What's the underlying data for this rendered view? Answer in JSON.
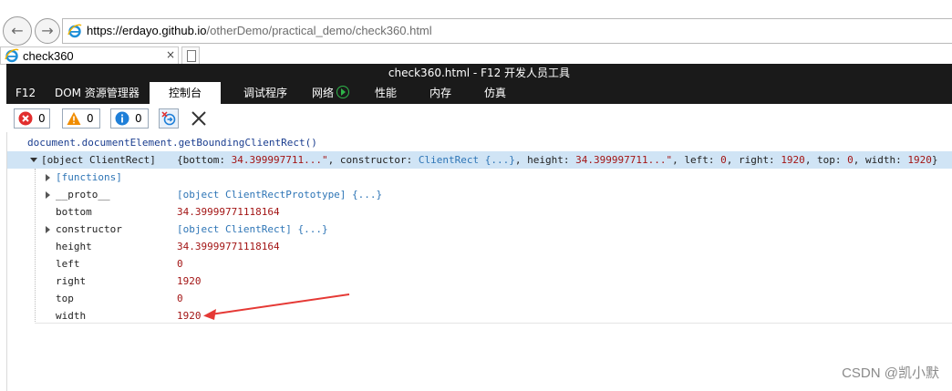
{
  "browser": {
    "url_host": "https://erdayo.github.io",
    "url_path": "/otherDemo/practical_demo/check360.html",
    "tab_title": "check360",
    "tab_close": "×"
  },
  "devtools": {
    "window_title": "check360.html - F12 开发人员工具",
    "tabs": [
      "F12",
      "DOM 资源管理器",
      "控制台",
      "调试程序",
      "网络",
      "性能",
      "内存",
      "仿真"
    ],
    "active_tab": "控制台",
    "counts": {
      "errors": "0",
      "warnings": "0",
      "messages": "0"
    }
  },
  "console": {
    "input": "document.documentElement.getBoundingClientRect()",
    "result_label": "[object ClientRect]",
    "summary": {
      "open": "{bottom: ",
      "bottom": "34.399997711...\"",
      "sep1": ", constructor: ",
      "ctor": "ClientRect {...}",
      "sep2": ", height: ",
      "height": "34.399997711...\"",
      "sep3": ", left: ",
      "left": "0",
      "sep4": ", right: ",
      "right": "1920",
      "sep5": ", top: ",
      "top": "0",
      "sep6": ", width: ",
      "width": "1920",
      "close": "}"
    },
    "props": {
      "functions": "[functions]",
      "proto_key": "__proto__",
      "proto_val": "[object ClientRectPrototype] {...}",
      "bottom_key": "bottom",
      "bottom_val": "34.39999771118164",
      "ctor_key": "constructor",
      "ctor_val": "[object ClientRect] {...}",
      "height_key": "height",
      "height_val": "34.39999771118164",
      "left_key": "left",
      "left_val": "0",
      "right_key": "right",
      "right_val": "1920",
      "top_key": "top",
      "top_val": "0",
      "width_key": "width",
      "width_val": "1920"
    }
  },
  "watermark": "CSDN @凯小默",
  "colors": {
    "annotation_arrow": "#e53935",
    "selected_row": "#d0e4f5",
    "devtools_bar": "#1a1a1a"
  }
}
